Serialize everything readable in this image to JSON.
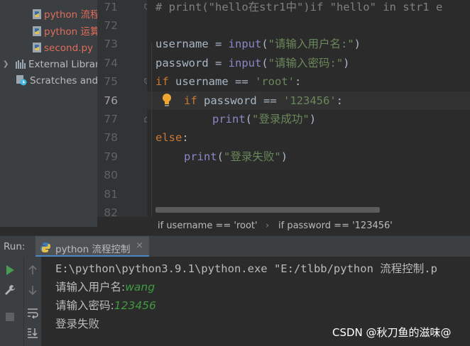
{
  "project_tree": {
    "items": [
      {
        "label": "python 流程",
        "icon": "python-file-icon",
        "color": "#e06c5a"
      },
      {
        "label": "python 运算",
        "icon": "python-file-icon",
        "color": "#e06c5a"
      },
      {
        "label": "second.py",
        "icon": "python-file-icon",
        "color": "#e06c5a"
      },
      {
        "label": "External Librar",
        "icon": "library-icon",
        "color": "#bbbbbb"
      },
      {
        "label": "Scratches and",
        "icon": "scratches-icon",
        "color": "#bbbbbb"
      }
    ]
  },
  "editor": {
    "line_numbers": [
      "71",
      "72",
      "73",
      "74",
      "75",
      "76",
      "77",
      "78",
      "79",
      "80",
      "81",
      "82"
    ],
    "current_line": "76",
    "lines": {
      "l71": "# print(\"hello在str1中\")if \"hello\" in str1 e",
      "l73a": "username = ",
      "l73b": "input",
      "l73c": "(",
      "l73d": "\"请输入用户名:\"",
      "l73e": ")",
      "l74a": "password = ",
      "l74b": "input",
      "l74c": "(",
      "l74d": "\"请输入密码:\"",
      "l74e": ")",
      "l75a": "if",
      "l75b": " username == ",
      "l75c": "'root'",
      "l75d": ":",
      "l76a": "if",
      "l76b": " password == ",
      "l76c": "'123456'",
      "l76d": ":",
      "l77a": "print",
      "l77b": "(",
      "l77c": "\"登录成功\"",
      "l77d": ")",
      "l78a": "else",
      "l78b": ":",
      "l79a": "print",
      "l79b": "(",
      "l79c": "\"登录失败\"",
      "l79d": ")"
    }
  },
  "breadcrumb": {
    "items": [
      "if username == 'root'",
      "if password == '123456'"
    ],
    "separator": "›"
  },
  "run_panel": {
    "label": "Run:",
    "tab_label": "python 流程控制",
    "close": "×",
    "console": {
      "command": "E:\\python\\python3.9.1\\python.exe \"E:/tlbb/python 流程控制.p",
      "prompt_user": "请输入用户名:",
      "input_user": "wang",
      "prompt_pass": "请输入密码:",
      "input_pass": "123456",
      "result": "登录失败"
    }
  },
  "watermark": "CSDN @秋刀鱼的滋味@",
  "colors": {
    "keyword": "#cc7832",
    "string": "#6a8759",
    "builtin": "#8888c6",
    "user_input": "#3f9b3f",
    "vcs_modified": "#e06c5a",
    "accent": "#4a88c7"
  }
}
